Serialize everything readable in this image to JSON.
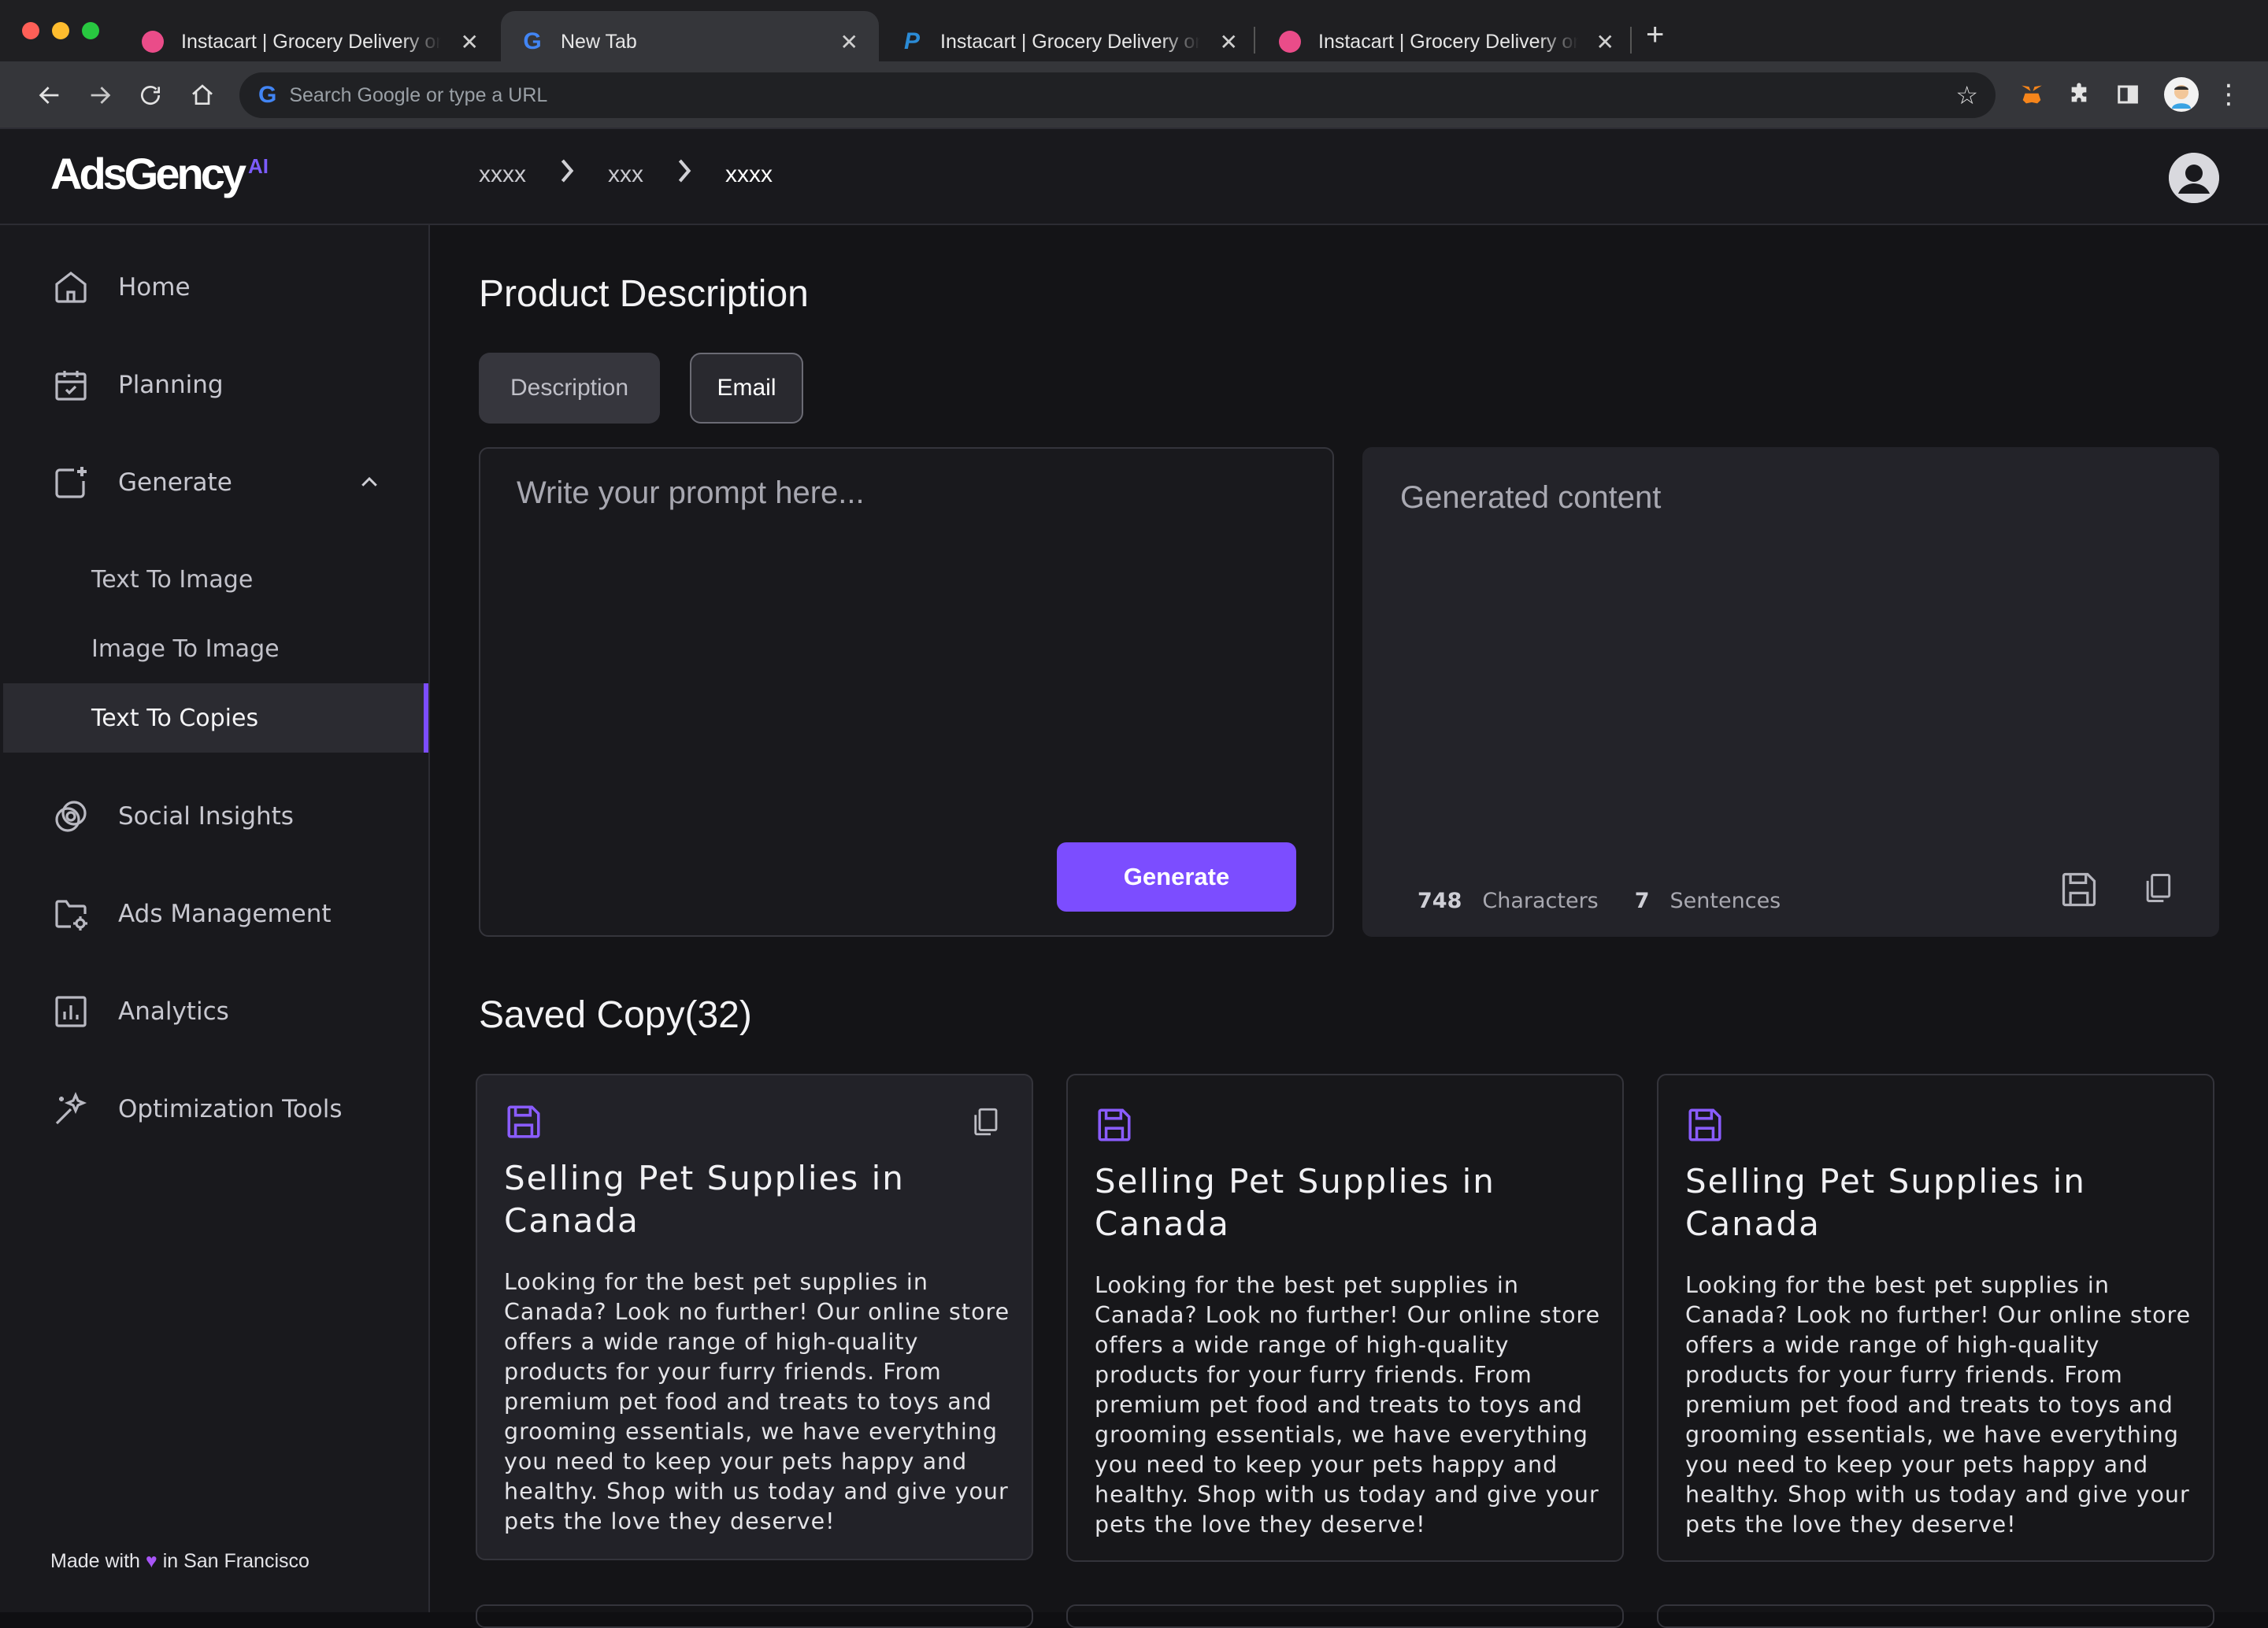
{
  "browser": {
    "tabs": [
      {
        "title": "Instacart | Grocery Delivery or",
        "favicon": "dribbble-icon"
      },
      {
        "title": "New Tab",
        "favicon": "google-icon"
      },
      {
        "title": "Instacart | Grocery Delivery or",
        "favicon": "paypal-icon"
      },
      {
        "title": "Instacart | Grocery Delivery or",
        "favicon": "dribbble-icon"
      }
    ],
    "omnibox_placeholder": "Search Google or type a URL"
  },
  "app": {
    "logo": "AdsGency",
    "logo_badge": "AI",
    "breadcrumb": [
      "xxxx",
      "xxx",
      "xxxx"
    ]
  },
  "sidebar": {
    "items": [
      {
        "label": "Home",
        "icon": "home-icon"
      },
      {
        "label": "Planning",
        "icon": "calendar-icon"
      },
      {
        "label": "Generate",
        "icon": "generate-icon"
      },
      {
        "label": "Social Insights",
        "icon": "social-insights-icon"
      },
      {
        "label": "Ads Management",
        "icon": "folder-gear-icon"
      },
      {
        "label": "Analytics",
        "icon": "analytics-icon"
      },
      {
        "label": "Optimization Tools",
        "icon": "magic-wand-icon"
      }
    ],
    "sub_items": [
      "Text To Image",
      "Image To Image",
      "Text To Copies"
    ],
    "footer_prefix": "Made with",
    "footer_suffix": "in San Francisco"
  },
  "main": {
    "title": "Product Description",
    "tabs": [
      "Description",
      "Email"
    ],
    "prompt_placeholder": "Write your prompt here...",
    "generate_label": "Generate",
    "generated_placeholder": "Generated content",
    "stats": {
      "characters_count": "748",
      "characters_label": "Characters",
      "sentences_count": "7",
      "sentences_label": "Sentences"
    },
    "saved_title": "Saved Copy(32)",
    "cards": [
      {
        "title": "Selling Pet Supplies in Canada",
        "body": "Looking for the best pet supplies in Canada? Look no further! Our online store offers a wide range of high-quality products for your furry friends. From premium pet food and treats to toys and grooming essentials, we have everything you need to keep your pets happy and healthy. Shop with us today and give your pets the love they deserve!"
      },
      {
        "title": "Selling Pet Supplies in Canada",
        "body": "Looking for the best pet supplies in Canada? Look no further! Our online store offers a wide range of high-quality products for your furry friends. From premium pet food and treats to toys and grooming essentials, we have everything you need to keep your pets happy and healthy. Shop with us today and give your pets the love they deserve!"
      },
      {
        "title": "Selling Pet Supplies in Canada",
        "body": "Looking for the best pet supplies in Canada? Look no further! Our online store offers a wide range of high-quality products for your furry friends. From premium pet food and treats to toys and grooming essentials, we have everything you need to keep your pets happy and healthy. Shop with us today and give your pets the love they deserve!"
      }
    ]
  },
  "colors": {
    "accent": "#7c4dff",
    "background": "#141417",
    "sidebar": "#19191d"
  }
}
